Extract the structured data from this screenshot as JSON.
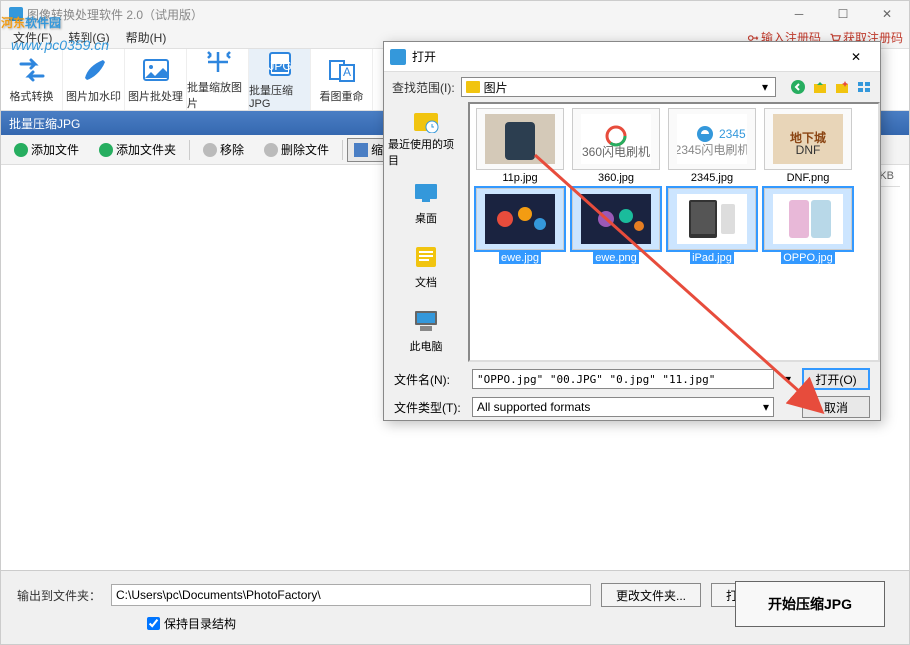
{
  "watermark": {
    "text1": "河东",
    "text2": "软件园",
    "url": "www.pc0359.cn"
  },
  "titlebar": {
    "title": "图像转换处理软件 2.0（试用版）"
  },
  "menubar": {
    "file": "文件(F)",
    "convert": "转到(G)",
    "help": "帮助(H)"
  },
  "reg": {
    "enter_code": "输入注册码",
    "get_code": "获取注册码"
  },
  "toolbar": {
    "t1": "格式转换",
    "t2": "图片加水印",
    "t3": "图片批处理",
    "t4": "批量缩放图片",
    "t5": "批量压缩JPG",
    "t6": "看图重命"
  },
  "subtitle": "批量压缩JPG",
  "actions": {
    "add_file": "添加文件",
    "add_folder": "添加文件夹",
    "remove": "移除",
    "remove_all": "删除文件",
    "thumb": "缩略图"
  },
  "list": {
    "col_kb": "KB"
  },
  "bottom": {
    "out_label": "输出到文件夹：",
    "out_path": "C:\\Users\\pc\\Documents\\PhotoFactory\\",
    "change_btn": "更改文件夹...",
    "open_btn": "打开文件夹",
    "keep_struct": "保持目录结构",
    "start_btn": "开始压缩JPG"
  },
  "dialog": {
    "title": "打开",
    "lookin_label": "查找范围(I):",
    "lookin_value": "图片",
    "sidebar": {
      "recent": "最近使用的项目",
      "desktop": "桌面",
      "docs": "文档",
      "pc": "此电脑"
    },
    "files": [
      {
        "name": "11p.jpg",
        "sel": false,
        "thumb": "phone"
      },
      {
        "name": "360.jpg",
        "sel": false,
        "thumb": "logo360"
      },
      {
        "name": "2345.jpg",
        "sel": false,
        "thumb": "logo2345"
      },
      {
        "name": "DNF.png",
        "sel": false,
        "thumb": "dnf"
      },
      {
        "name": "ewe.jpg",
        "sel": true,
        "thumb": "game1"
      },
      {
        "name": "ewe.png",
        "sel": true,
        "thumb": "game2"
      },
      {
        "name": "iPad.jpg",
        "sel": true,
        "thumb": "ipad"
      },
      {
        "name": "OPPO.jpg",
        "sel": true,
        "thumb": "oppo"
      }
    ],
    "filename_label": "文件名(N):",
    "filename_value": "\"OPPO.jpg\" \"00.JPG\" \"0.jpg\" \"11.jpg\"",
    "filetype_label": "文件类型(T):",
    "filetype_value": "All supported formats",
    "open_btn": "打开(O)",
    "cancel_btn": "取消"
  }
}
